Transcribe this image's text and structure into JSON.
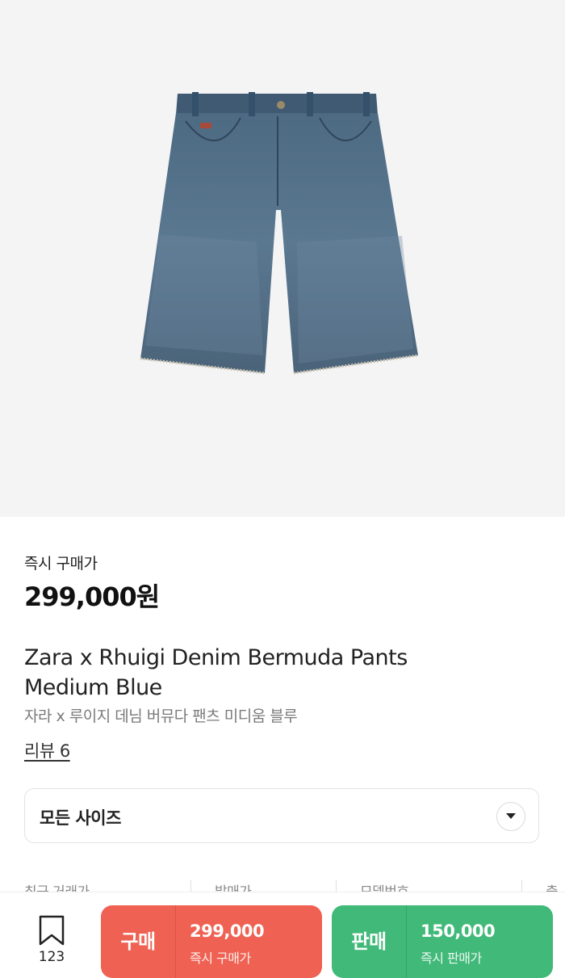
{
  "product": {
    "image_icon": "denim-shorts-image",
    "price_label": "즉시 구매가",
    "price": "299,000원",
    "title_en_line1": "Zara x Rhuigi Denim Bermuda Pants",
    "title_en_line2": "Medium Blue",
    "title_ko": "자라 x 루이지 데님 버뮤다 팬츠 미디움 블루",
    "review_link": "리뷰 6"
  },
  "size_selector": {
    "label": "모든 사이즈",
    "icon": "chevron-down-icon"
  },
  "info_row": {
    "recent_trade_label": "최근 거래가",
    "release_price_label": "발매가",
    "model_number_label": "모델번호",
    "release_date_label": "출시일"
  },
  "bottom_bar": {
    "bookmark_icon": "bookmark-icon",
    "bookmark_count": "123",
    "buy": {
      "label": "구매",
      "amount": "299,000",
      "sub": "즉시 구매가",
      "color": "#ef6253"
    },
    "sell": {
      "label": "판매",
      "amount": "150,000",
      "sub": "즉시 판매가",
      "color": "#41b979"
    }
  }
}
